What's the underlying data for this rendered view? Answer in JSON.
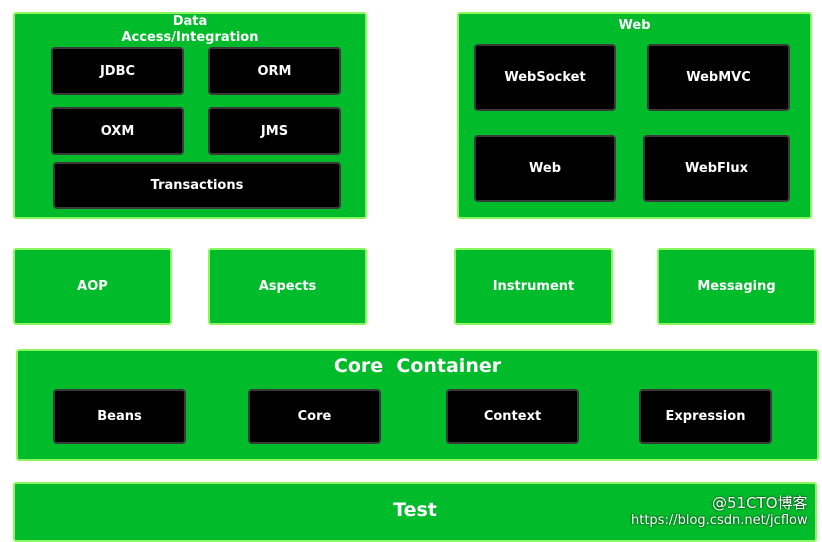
{
  "data_access": {
    "title": "Data\nAccess/Integration",
    "items": [
      "JDBC",
      "ORM",
      "OXM",
      "JMS",
      "Transactions"
    ]
  },
  "web": {
    "title": "Web",
    "items": [
      "WebSocket",
      "WebMVC",
      "Web",
      "WebFlux"
    ]
  },
  "middle": [
    "AOP",
    "Aspects",
    "Instrument",
    "Messaging"
  ],
  "core_container": {
    "title": "Core  Container",
    "items": [
      "Beans",
      "Core",
      "Context",
      "Expression"
    ]
  },
  "test": {
    "title": "Test"
  },
  "watermark": {
    "brand": "@51CTO博客",
    "url": "https://blog.csdn.net/jcflow"
  },
  "colors": {
    "module_green": "#00bb2a",
    "border_green": "#8cf55f",
    "box_black": "#000000"
  }
}
